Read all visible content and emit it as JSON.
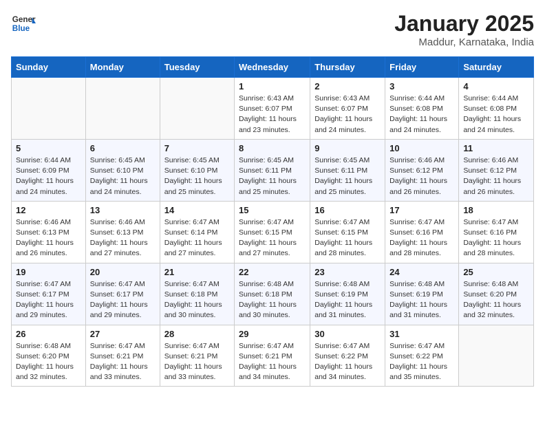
{
  "header": {
    "logo_line1": "General",
    "logo_line2": "Blue",
    "month_title": "January 2025",
    "subtitle": "Maddur, Karnataka, India"
  },
  "weekdays": [
    "Sunday",
    "Monday",
    "Tuesday",
    "Wednesday",
    "Thursday",
    "Friday",
    "Saturday"
  ],
  "weeks": [
    [
      {
        "day": "",
        "info": ""
      },
      {
        "day": "",
        "info": ""
      },
      {
        "day": "",
        "info": ""
      },
      {
        "day": "1",
        "info": "Sunrise: 6:43 AM\nSunset: 6:07 PM\nDaylight: 11 hours\nand 23 minutes."
      },
      {
        "day": "2",
        "info": "Sunrise: 6:43 AM\nSunset: 6:07 PM\nDaylight: 11 hours\nand 24 minutes."
      },
      {
        "day": "3",
        "info": "Sunrise: 6:44 AM\nSunset: 6:08 PM\nDaylight: 11 hours\nand 24 minutes."
      },
      {
        "day": "4",
        "info": "Sunrise: 6:44 AM\nSunset: 6:08 PM\nDaylight: 11 hours\nand 24 minutes."
      }
    ],
    [
      {
        "day": "5",
        "info": "Sunrise: 6:44 AM\nSunset: 6:09 PM\nDaylight: 11 hours\nand 24 minutes."
      },
      {
        "day": "6",
        "info": "Sunrise: 6:45 AM\nSunset: 6:10 PM\nDaylight: 11 hours\nand 24 minutes."
      },
      {
        "day": "7",
        "info": "Sunrise: 6:45 AM\nSunset: 6:10 PM\nDaylight: 11 hours\nand 25 minutes."
      },
      {
        "day": "8",
        "info": "Sunrise: 6:45 AM\nSunset: 6:11 PM\nDaylight: 11 hours\nand 25 minutes."
      },
      {
        "day": "9",
        "info": "Sunrise: 6:45 AM\nSunset: 6:11 PM\nDaylight: 11 hours\nand 25 minutes."
      },
      {
        "day": "10",
        "info": "Sunrise: 6:46 AM\nSunset: 6:12 PM\nDaylight: 11 hours\nand 26 minutes."
      },
      {
        "day": "11",
        "info": "Sunrise: 6:46 AM\nSunset: 6:12 PM\nDaylight: 11 hours\nand 26 minutes."
      }
    ],
    [
      {
        "day": "12",
        "info": "Sunrise: 6:46 AM\nSunset: 6:13 PM\nDaylight: 11 hours\nand 26 minutes."
      },
      {
        "day": "13",
        "info": "Sunrise: 6:46 AM\nSunset: 6:13 PM\nDaylight: 11 hours\nand 27 minutes."
      },
      {
        "day": "14",
        "info": "Sunrise: 6:47 AM\nSunset: 6:14 PM\nDaylight: 11 hours\nand 27 minutes."
      },
      {
        "day": "15",
        "info": "Sunrise: 6:47 AM\nSunset: 6:15 PM\nDaylight: 11 hours\nand 27 minutes."
      },
      {
        "day": "16",
        "info": "Sunrise: 6:47 AM\nSunset: 6:15 PM\nDaylight: 11 hours\nand 28 minutes."
      },
      {
        "day": "17",
        "info": "Sunrise: 6:47 AM\nSunset: 6:16 PM\nDaylight: 11 hours\nand 28 minutes."
      },
      {
        "day": "18",
        "info": "Sunrise: 6:47 AM\nSunset: 6:16 PM\nDaylight: 11 hours\nand 28 minutes."
      }
    ],
    [
      {
        "day": "19",
        "info": "Sunrise: 6:47 AM\nSunset: 6:17 PM\nDaylight: 11 hours\nand 29 minutes."
      },
      {
        "day": "20",
        "info": "Sunrise: 6:47 AM\nSunset: 6:17 PM\nDaylight: 11 hours\nand 29 minutes."
      },
      {
        "day": "21",
        "info": "Sunrise: 6:47 AM\nSunset: 6:18 PM\nDaylight: 11 hours\nand 30 minutes."
      },
      {
        "day": "22",
        "info": "Sunrise: 6:48 AM\nSunset: 6:18 PM\nDaylight: 11 hours\nand 30 minutes."
      },
      {
        "day": "23",
        "info": "Sunrise: 6:48 AM\nSunset: 6:19 PM\nDaylight: 11 hours\nand 31 minutes."
      },
      {
        "day": "24",
        "info": "Sunrise: 6:48 AM\nSunset: 6:19 PM\nDaylight: 11 hours\nand 31 minutes."
      },
      {
        "day": "25",
        "info": "Sunrise: 6:48 AM\nSunset: 6:20 PM\nDaylight: 11 hours\nand 32 minutes."
      }
    ],
    [
      {
        "day": "26",
        "info": "Sunrise: 6:48 AM\nSunset: 6:20 PM\nDaylight: 11 hours\nand 32 minutes."
      },
      {
        "day": "27",
        "info": "Sunrise: 6:47 AM\nSunset: 6:21 PM\nDaylight: 11 hours\nand 33 minutes."
      },
      {
        "day": "28",
        "info": "Sunrise: 6:47 AM\nSunset: 6:21 PM\nDaylight: 11 hours\nand 33 minutes."
      },
      {
        "day": "29",
        "info": "Sunrise: 6:47 AM\nSunset: 6:21 PM\nDaylight: 11 hours\nand 34 minutes."
      },
      {
        "day": "30",
        "info": "Sunrise: 6:47 AM\nSunset: 6:22 PM\nDaylight: 11 hours\nand 34 minutes."
      },
      {
        "day": "31",
        "info": "Sunrise: 6:47 AM\nSunset: 6:22 PM\nDaylight: 11 hours\nand 35 minutes."
      },
      {
        "day": "",
        "info": ""
      }
    ]
  ]
}
